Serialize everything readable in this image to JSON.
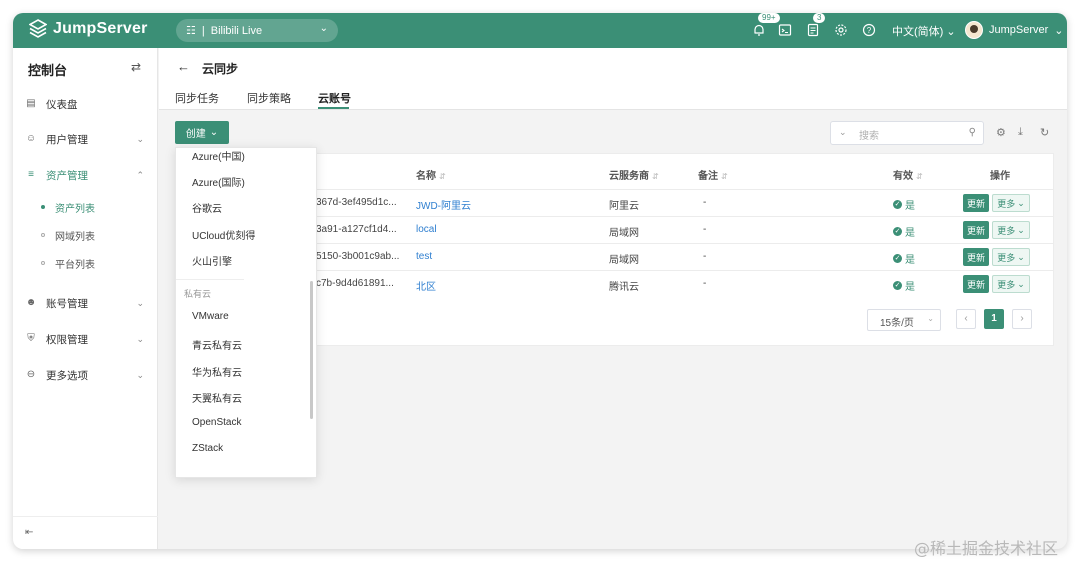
{
  "brand": {
    "name": "JumpServer",
    "accent": "#3b8f76"
  },
  "topbar": {
    "org": "Bilibili Live",
    "notify_badge": "99+",
    "ticket_badge": "3",
    "language": "中文(简体)",
    "username": "JumpServer"
  },
  "sidebar": {
    "title": "控制台",
    "items": [
      {
        "label": "仪表盘",
        "icon": "dashboard-icon"
      },
      {
        "label": "用户管理",
        "icon": "users-icon"
      },
      {
        "label": "资产管理",
        "icon": "assets-icon"
      },
      {
        "label": "账号管理",
        "icon": "accounts-icon"
      },
      {
        "label": "权限管理",
        "icon": "shield-icon"
      },
      {
        "label": "更多选项",
        "icon": "more-icon"
      }
    ],
    "subitems": [
      "资产列表",
      "网域列表",
      "平台列表"
    ]
  },
  "page": {
    "title": "云同步",
    "tabs": [
      "同步任务",
      "同步策略",
      "云账号"
    ],
    "active_tab": "云账号"
  },
  "toolbar": {
    "create_label": "创建",
    "search_placeholder": "搜索"
  },
  "table": {
    "headers": [
      "名称",
      "云服务商",
      "备注",
      "有效",
      "操作"
    ],
    "rows": [
      {
        "id": "367d-3ef495d1c...",
        "name": "JWD-阿里云",
        "provider": "阿里云",
        "comment": "-",
        "valid": "是"
      },
      {
        "id": "3a91-a127cf1d4...",
        "name": "local",
        "provider": "局域网",
        "comment": "-",
        "valid": "是"
      },
      {
        "id": "5150-3b001c9ab...",
        "name": "test",
        "provider": "局域网",
        "comment": "-",
        "valid": "是"
      },
      {
        "id": "c7b-9d4d61891...",
        "name": "北区",
        "provider": "腾讯云",
        "comment": "-",
        "valid": "是"
      }
    ],
    "update_label": "更新",
    "more_label": "更多"
  },
  "pagination": {
    "page_size": "15条/页",
    "current": "1"
  },
  "dropdown": {
    "public_items": [
      "Azure(中国)",
      "Azure(国际)",
      "谷歌云",
      "UCloud优刻得",
      "火山引擎"
    ],
    "private_group": "私有云",
    "private_items": [
      "VMware",
      "青云私有云",
      "华为私有云",
      "天翼私有云",
      "OpenStack",
      "ZStack"
    ]
  },
  "watermark": "@稀土掘金技术社区"
}
